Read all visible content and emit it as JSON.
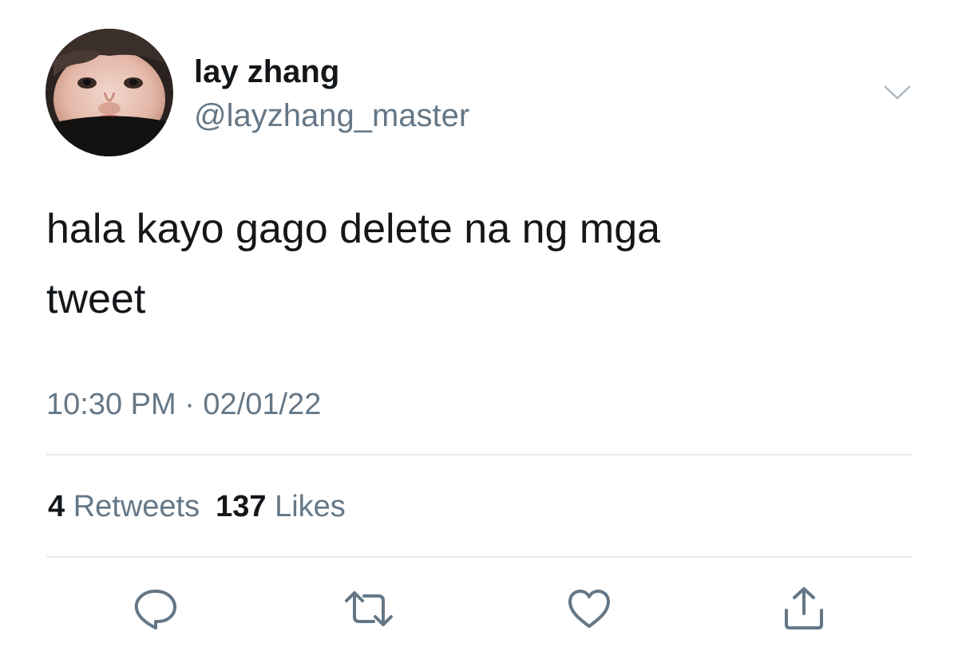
{
  "user": {
    "display_name": "lay zhang",
    "handle": "@layzhang_master"
  },
  "tweet": {
    "text_line1": "hala kayo gago delete na ng mga",
    "text_line2": "tweet",
    "timestamp": "10:30 PM · 02/01/22"
  },
  "stats": {
    "retweets_count": "4",
    "retweets_label": "Retweets",
    "likes_count": "137",
    "likes_label": "Likes"
  },
  "icons": {
    "menu": "chevron-down-icon",
    "reply": "reply-icon",
    "retweet": "retweet-icon",
    "like": "like-heart-icon",
    "share": "share-icon"
  },
  "colors": {
    "primary_text": "#14171a",
    "secondary_text": "#657786",
    "divider": "#e6ecf0",
    "icon": "#657786"
  }
}
